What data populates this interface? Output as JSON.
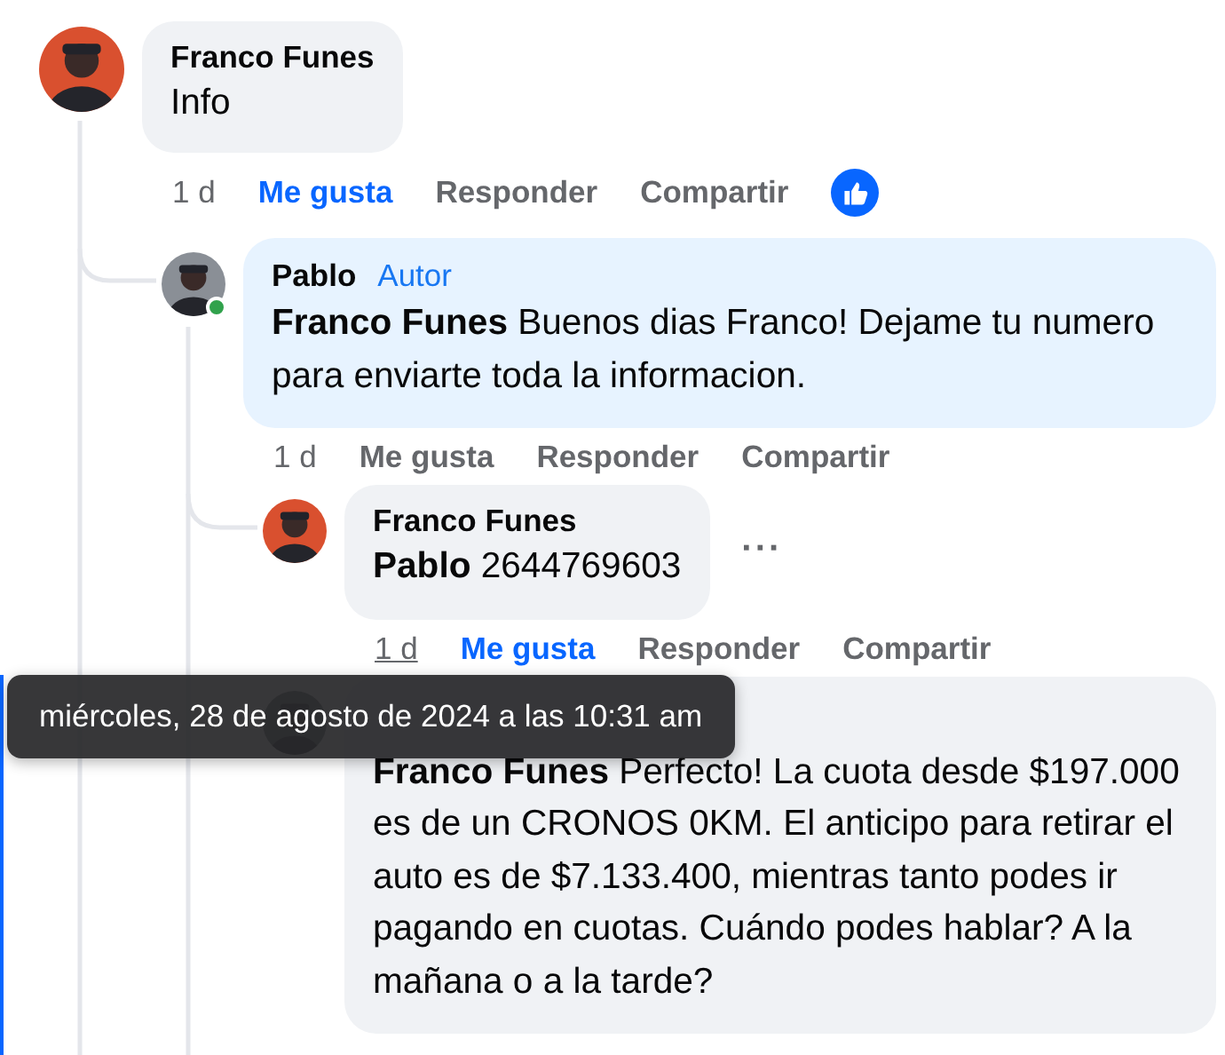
{
  "comments": [
    {
      "author": "Franco Funes",
      "color": "#d9502f",
      "text": "Info",
      "time": "1 d",
      "time_hovered": false,
      "like": "Me gusta",
      "liked": true,
      "reply": "Responder",
      "share": "Compartir",
      "reaction": true,
      "children": [
        {
          "author": "Pablo",
          "badge": "Autor",
          "color": "#8a8f96",
          "online": true,
          "text": "**Franco Funes** Buenos dias Franco! Dejame tu numero para enviarte toda la informacion.",
          "time": "1 d",
          "time_hovered": false,
          "like": "Me gusta",
          "liked": false,
          "reply": "Responder",
          "share": "Compartir",
          "children": [
            {
              "author": "Franco Funes",
              "color": "#d9502f",
              "text": "**Pablo** 2644769603",
              "more": "···",
              "time": "1 d",
              "time_hovered": true,
              "like": "Me gusta",
              "liked": true,
              "reply": "Responder",
              "share": "Compartir"
            },
            {
              "text": "**Franco Funes** Perfecto! La cuota desde $197.000 es de un CRONOS 0KM. El anticipo para retirar el auto es de $7.133.400, mientras tanto podes ir pagando en cuotas. Cuándo podes hablar? A la mañana o a la tarde?"
            }
          ]
        }
      ]
    }
  ],
  "tooltip": {
    "text": "miércoles, 28 de agosto de 2024 a las 10:31 am"
  }
}
